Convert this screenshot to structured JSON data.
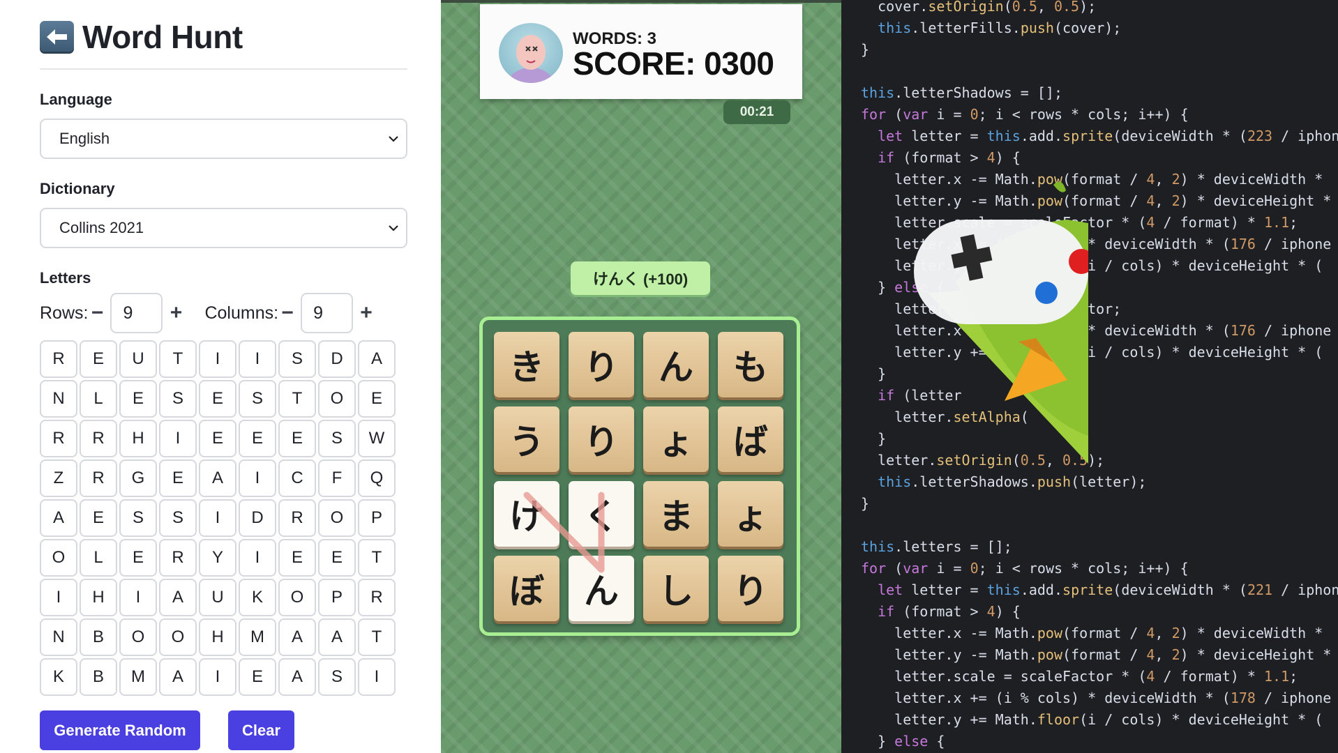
{
  "app": {
    "title": "Word Hunt",
    "back_icon": "back-arrow-icon"
  },
  "settings": {
    "language_label": "Language",
    "language_value": "English",
    "dictionary_label": "Dictionary",
    "dictionary_value": "Collins 2021",
    "letters_label": "Letters",
    "rows_label": "Rows:",
    "rows_value": "9",
    "columns_label": "Columns:",
    "columns_value": "9"
  },
  "letter_grid": [
    [
      "R",
      "E",
      "U",
      "T",
      "I",
      "I",
      "S",
      "D",
      "A"
    ],
    [
      "N",
      "L",
      "E",
      "S",
      "E",
      "S",
      "T",
      "O",
      "E"
    ],
    [
      "R",
      "R",
      "H",
      "I",
      "E",
      "E",
      "E",
      "S",
      "W"
    ],
    [
      "Z",
      "R",
      "G",
      "E",
      "A",
      "I",
      "C",
      "F",
      "Q"
    ],
    [
      "A",
      "E",
      "S",
      "S",
      "I",
      "D",
      "R",
      "O",
      "P"
    ],
    [
      "O",
      "L",
      "E",
      "R",
      "Y",
      "I",
      "E",
      "E",
      "T"
    ],
    [
      "I",
      "H",
      "I",
      "A",
      "U",
      "K",
      "O",
      "P",
      "R"
    ],
    [
      "N",
      "B",
      "O",
      "O",
      "H",
      "M",
      "A",
      "A",
      "T"
    ],
    [
      "K",
      "B",
      "M",
      "A",
      "I",
      "E",
      "A",
      "S",
      "I"
    ]
  ],
  "actions": {
    "generate_label": "Generate Random",
    "clear_label": "Clear"
  },
  "game": {
    "words_label": "WORDS: 3",
    "score_label": "SCORE: 0300",
    "timer": "00:21",
    "found_word_toast": "けんく (+100)",
    "tiles": [
      {
        "char": "き",
        "selected": false
      },
      {
        "char": "り",
        "selected": false
      },
      {
        "char": "ん",
        "selected": false
      },
      {
        "char": "も",
        "selected": false
      },
      {
        "char": "う",
        "selected": false
      },
      {
        "char": "り",
        "selected": false
      },
      {
        "char": "ょ",
        "selected": false
      },
      {
        "char": "ば",
        "selected": false
      },
      {
        "char": "け",
        "selected": true
      },
      {
        "char": "く",
        "selected": true
      },
      {
        "char": "ま",
        "selected": false
      },
      {
        "char": "ょ",
        "selected": false
      },
      {
        "char": "ぼ",
        "selected": false
      },
      {
        "char": "ん",
        "selected": true
      },
      {
        "char": "し",
        "selected": false
      },
      {
        "char": "り",
        "selected": false
      }
    ]
  },
  "editor": {
    "lines": [
      "  cover.setOrigin(0.5, 0.5);",
      "  this.letterFills.push(cover);",
      "}",
      "",
      "this.letterShadows = [];",
      "for (var i = 0; i < rows * cols; i++) {",
      "  let letter = this.add.sprite(deviceWidth * (223 / iphone",
      "  if (format > 4) {",
      "    letter.x -= Math.pow(format / 4, 2) * deviceWidth *",
      "    letter.y -= Math.pow(format / 4, 2) * deviceHeight *",
      "    letter.scale = scaleFactor * (4 / format) * 1.1;",
      "    letter.x += (i % cols) * deviceWidth * (176 / iphone",
      "    letter.y += Math.floor(i / cols) * deviceHeight * (",
      "  } else {",
      "    letter.scale = scaleFactor;",
      "    letter.x += (i % cols) * deviceWidth * (176 / iphone",
      "    letter.y += Math.floor(i / cols) * deviceHeight * (",
      "  }",
      "  if (letter",
      "    letter.setAlpha(",
      "  }",
      "  letter.setOrigin(0.5, 0.5);",
      "  this.letterShadows.push(letter);",
      "}",
      "",
      "this.letters = [];",
      "for (var i = 0; i < rows * cols; i++) {",
      "  let letter = this.add.sprite(deviceWidth * (221 / iphone",
      "  if (format > 4) {",
      "    letter.x -= Math.pow(format / 4, 2) * deviceWidth *",
      "    letter.y -= Math.pow(format / 4, 2) * deviceHeight *",
      "    letter.scale = scaleFactor * (4 / format) * 1.1;",
      "    letter.x += (i % cols) * deviceWidth * (178 / iphone",
      "    letter.y += Math.floor(i / cols) * deviceHeight * (",
      "  } else {"
    ]
  },
  "colors": {
    "primary_button": "#4a3fe0",
    "game_background": "#6a9b6d",
    "board_border": "#a8ef93",
    "editor_background": "#1e1f22"
  },
  "overlay_icon": "game-controller-parrot-logo"
}
